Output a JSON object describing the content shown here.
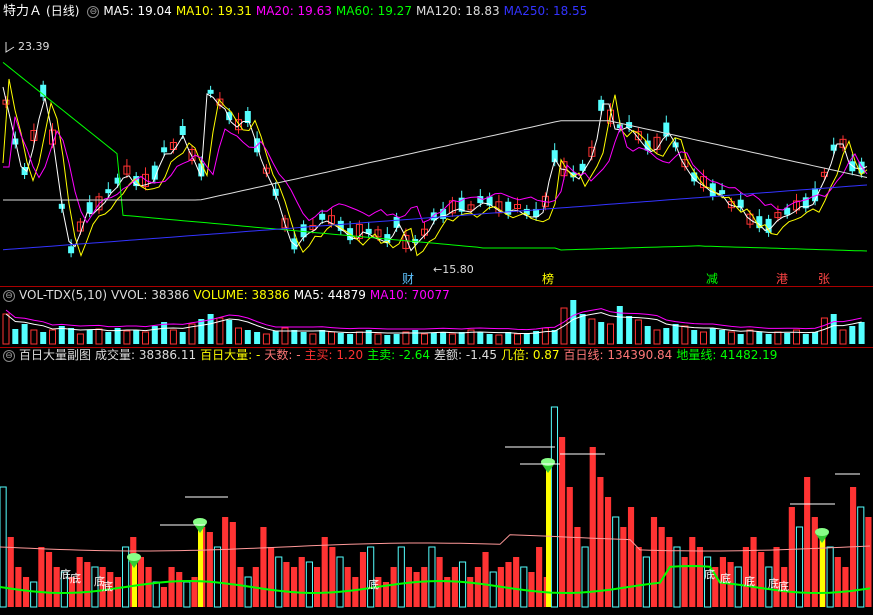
{
  "price_panel": {
    "stock_name": "特力Ａ",
    "period": "(日线)",
    "indicators": [
      {
        "label": "MA5: 19.04",
        "color": "#ffffff"
      },
      {
        "label": "MA10: 19.31",
        "color": "#ffff00"
      },
      {
        "label": "MA20: 19.63",
        "color": "#ff00ff"
      },
      {
        "label": "MA60: 19.27",
        "color": "#00ff00"
      },
      {
        "label": "MA120: 18.83",
        "color": "#dddddd"
      },
      {
        "label": "MA250: 18.55",
        "color": "#3333ff"
      }
    ],
    "high_label": "23.39",
    "low_label": "15.80",
    "event_markers": [
      {
        "text": "财",
        "color": "#5fc3ff"
      },
      {
        "text": "榜",
        "color": "#ffff00"
      },
      {
        "text": "减",
        "color": "#00ff00"
      },
      {
        "text": "港",
        "color": "#ff4444"
      },
      {
        "text": "张",
        "color": "#ff4444"
      }
    ]
  },
  "volume_panel": {
    "indicators": [
      {
        "label": "VOL-TDX(5,10)",
        "color": "#dddddd"
      },
      {
        "label": "VVOL: 38386",
        "color": "#dddddd"
      },
      {
        "label": "VOLUME: 38386",
        "color": "#ffff00"
      },
      {
        "label": "MA5: 44879",
        "color": "#ffffff"
      },
      {
        "label": "MA10: 70077",
        "color": "#ff00ff"
      }
    ]
  },
  "bai_panel": {
    "indicators": [
      {
        "label": "百日大量副图",
        "color": "#dddddd"
      },
      {
        "label": "成交量: 38386.11",
        "color": "#dddddd"
      },
      {
        "label": "百日大量: -",
        "color": "#ffff00"
      },
      {
        "label": "天数: -",
        "color": "#ff7777"
      },
      {
        "label": "主买: 1.20",
        "color": "#ff3333"
      },
      {
        "label": "主卖: -2.64",
        "color": "#00ff00"
      },
      {
        "label": "差额: -1.45",
        "color": "#dddddd"
      },
      {
        "label": "几倍: 0.87",
        "color": "#ffff00"
      },
      {
        "label": "百日线: 134390.84",
        "color": "#ff7777"
      },
      {
        "label": "地量线: 41482.19",
        "color": "#00ff00"
      }
    ],
    "bottom_label": "底"
  },
  "colors": {
    "up": "#ff3333",
    "down": "#54ffff",
    "background": "#000000",
    "separator": "#aa0000"
  }
}
